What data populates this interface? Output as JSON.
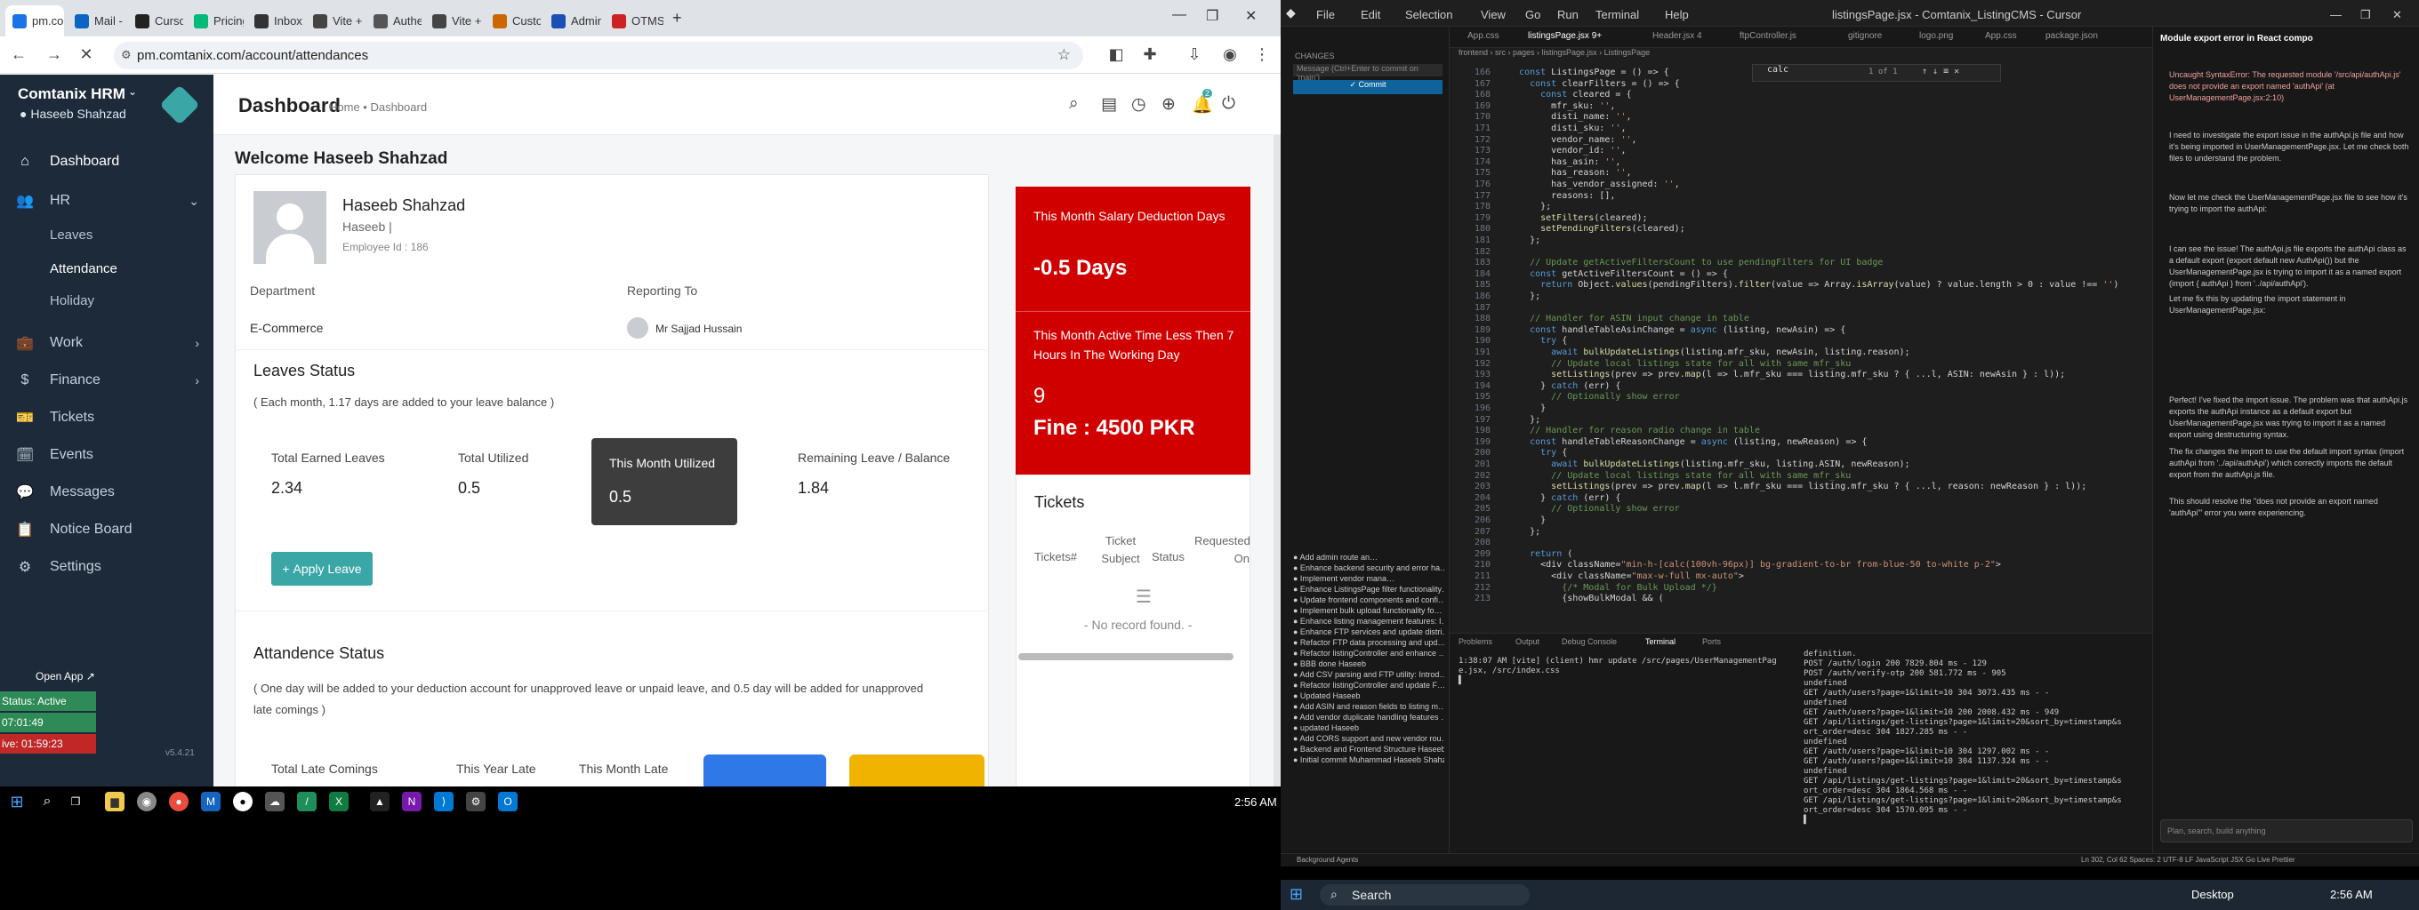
{
  "browser": {
    "tabs": [
      {
        "label": "pm.co",
        "color": "#1a73e8",
        "active": true
      },
      {
        "label": "Mail -",
        "color": "#0a66c2"
      },
      {
        "label": "Curso",
        "color": "#222"
      },
      {
        "label": "Pricing",
        "color": "#0b7"
      },
      {
        "label": "Inbox",
        "color": "#333"
      },
      {
        "label": "Vite +",
        "color": "#444"
      },
      {
        "label": "Authe",
        "color": "#555"
      },
      {
        "label": "Vite +",
        "color": "#444"
      },
      {
        "label": "Custo",
        "color": "#c60"
      },
      {
        "label": "Admin",
        "color": "#1b4fb5"
      },
      {
        "label": "OTMS",
        "color": "#c22"
      }
    ],
    "new_tab": "+",
    "url": "pm.comtanix.com/account/attendances"
  },
  "sidebar": {
    "brand": "Comtanix HRM",
    "user": "Haseeb Shahzad",
    "items": [
      {
        "label": "Dashboard",
        "icon": "⌂"
      },
      {
        "label": "HR",
        "icon": "👥"
      },
      {
        "label": "Work",
        "icon": "💼"
      },
      {
        "label": "Finance",
        "icon": "$"
      },
      {
        "label": "Tickets",
        "icon": "🎫"
      },
      {
        "label": "Events",
        "icon": "🗓"
      },
      {
        "label": "Messages",
        "icon": "💬"
      },
      {
        "label": "Notice Board",
        "icon": "📋"
      },
      {
        "label": "Settings",
        "icon": "⚙"
      }
    ],
    "hr_sub": [
      "Leaves",
      "Attendance",
      "Holiday"
    ],
    "open_app": "Open App ↗",
    "status_active": "Status: Active",
    "timer1": "07:01:49",
    "timer2": "01:59:23",
    "timer2_prefix": "ive: ",
    "version": "v5.4.21"
  },
  "header": {
    "title": "Dashboard",
    "breadcrumb": "Home • Dashboard",
    "badge": "2"
  },
  "main": {
    "welcome": "Welcome Haseeb Shahzad",
    "profile": {
      "name": "Haseeb Shahzad",
      "handle": "Haseeb |",
      "employee_id": "Employee Id : 186",
      "department_label": "Department",
      "department": "E-Commerce",
      "reporting_label": "Reporting To",
      "reporting": "Mr Sajjad Hussain"
    },
    "leaves": {
      "title": "Leaves Status",
      "note": "( Each month, 1.17 days are added to your leave balance )",
      "stats": [
        {
          "label": "Total Earned Leaves",
          "value": "2.34"
        },
        {
          "label": "Total Utilized",
          "value": "0.5"
        },
        {
          "label": "This Month Utilized",
          "value": "0.5"
        },
        {
          "label": "Remaining Leave / Balance",
          "value": "1.84"
        }
      ],
      "apply": "Apply Leave"
    },
    "attendance": {
      "title": "Attandence Status",
      "note": "( One day will be added to your deduction account for unapproved leave or unpaid leave, and 0.5 day will be added for unapproved late comings )",
      "cols": [
        "Total Late Comings",
        "This Year Late",
        "This Month Late"
      ]
    },
    "salary": {
      "title": "This Month Salary Deduction Days",
      "value": "-0.5 Days",
      "active_title": "This Month Active Time Less Then 7 Hours In The Working Day",
      "count": "9",
      "fine": "Fine : 4500 PKR"
    },
    "tickets": {
      "title": "Tickets",
      "cols": [
        "Tickets#",
        "Ticket Subject",
        "Status",
        "Requested On"
      ],
      "empty": "- No record found. -"
    }
  },
  "taskbar_left": {
    "time": "2:56 AM"
  },
  "editor": {
    "menu": [
      "File",
      "Edit",
      "Selection",
      "View",
      "Go",
      "Run",
      "Terminal",
      "Help"
    ],
    "window_title": "listingsPage.jsx - Comtanix_ListingCMS - Cursor",
    "tabs": [
      "App.css",
      "listingsPage.jsx 9+",
      "Header.jsx 4",
      "ftpController.js",
      "gitignore",
      "logo.png",
      "App.css",
      "package.json"
    ],
    "breadcrumb": "frontend › src › pages › listingsPage.jsx › ListingsPage",
    "find": "calc",
    "find_count": "1 of 1",
    "code": [
      [
        "166",
        "  const ListingsPage = () => {"
      ],
      [
        "167",
        "    const clearFilters = () => {"
      ],
      [
        "168",
        "      const cleared = {"
      ],
      [
        "169",
        "        mfr_sku: '',"
      ],
      [
        "170",
        "        disti_name: '',"
      ],
      [
        "171",
        "        disti_sku: '',"
      ],
      [
        "172",
        "        vendor_name: '',"
      ],
      [
        "173",
        "        vendor_id: '',"
      ],
      [
        "174",
        "        has_asin: '',"
      ],
      [
        "175",
        "        has_reason: '',"
      ],
      [
        "176",
        "        has_vendor_assigned: '',"
      ],
      [
        "177",
        "        reasons: [],"
      ],
      [
        "178",
        "      };"
      ],
      [
        "179",
        "      setFilters(cleared);"
      ],
      [
        "180",
        "      setPendingFilters(cleared);"
      ],
      [
        "181",
        "    };"
      ],
      [
        "182",
        ""
      ],
      [
        "183",
        "    // Update getActiveFiltersCount to use pendingFilters for UI badge"
      ],
      [
        "184",
        "    const getActiveFiltersCount = () => {"
      ],
      [
        "185",
        "      return Object.values(pendingFilters).filter(value => Array.isArray(value) ? value.length > 0 : value !== '')"
      ],
      [
        "186",
        "    };"
      ],
      [
        "187",
        ""
      ],
      [
        "188",
        "    // Handler for ASIN input change in table"
      ],
      [
        "189",
        "    const handleTableAsinChange = async (listing, newAsin) => {"
      ],
      [
        "190",
        "      try {"
      ],
      [
        "191",
        "        await bulkUpdateListings(listing.mfr_sku, newAsin, listing.reason);"
      ],
      [
        "192",
        "        // Update local listings state for all with same mfr_sku"
      ],
      [
        "193",
        "        setListings(prev => prev.map(l => l.mfr_sku === listing.mfr_sku ? { ...l, ASIN: newAsin } : l));"
      ],
      [
        "194",
        "      } catch (err) {"
      ],
      [
        "195",
        "        // Optionally show error"
      ],
      [
        "196",
        "      }"
      ],
      [
        "197",
        "    };"
      ],
      [
        "198",
        "    // Handler for reason radio change in table"
      ],
      [
        "199",
        "    const handleTableReasonChange = async (listing, newReason) => {"
      ],
      [
        "200",
        "      try {"
      ],
      [
        "201",
        "        await bulkUpdateListings(listing.mfr_sku, listing.ASIN, newReason);"
      ],
      [
        "202",
        "        // Update local listings state for all with same mfr_sku"
      ],
      [
        "203",
        "        setListings(prev => prev.map(l => l.mfr_sku === listing.mfr_sku ? { ...l, reason: newReason } : l));"
      ],
      [
        "204",
        "      } catch (err) {"
      ],
      [
        "205",
        "        // Optionally show error"
      ],
      [
        "206",
        "      }"
      ],
      [
        "207",
        "    };"
      ],
      [
        "208",
        ""
      ],
      [
        "209",
        "    return ("
      ],
      [
        "210",
        "      <div className=\"min-h-[calc(100vh-96px)] bg-gradient-to-br from-blue-50 to-white p-2\">"
      ],
      [
        "211",
        "        <div className=\"max-w-full mx-auto\">"
      ],
      [
        "212",
        "          {/* Modal for Bulk Upload */}"
      ],
      [
        "213",
        "          {showBulkModal && ("
      ]
    ],
    "scm_header": "CHANGES",
    "scm_msg": "Message (Ctrl+Enter to commit on 'main')",
    "scm_commit": "✓ Commit",
    "commits": [
      "Add admin route an…",
      "Enhance backend security and error ha…",
      "Implement vendor mana…",
      "Enhance ListingsPage filter functionality…",
      "Update frontend components and confi…",
      "Implement bulk upload functionality fo…",
      "Enhance listing management features: I…",
      "Enhance FTP services and update distri…",
      "Refactor FTP data processing and upd…",
      "Refactor listingController and enhance …",
      "BBB done  Haseeb",
      "Add CSV parsing and FTP utility: Introd…",
      "Refactor listingController and update F…",
      "Updated  Haseeb",
      "Add ASIN and reason fields to listing m…",
      "Add vendor duplicate handling features …",
      "updated  Haseeb",
      "Add CORS support and new vendor rou…",
      "Backend and Frontend Structure  Haseeb",
      "Initial commit  Muhammad Haseeb Shahzad"
    ],
    "panel_tabs": [
      "Problems",
      "Output",
      "Debug Console",
      "Terminal",
      "Ports"
    ],
    "term_left": [
      "1:38:07 AM [vite] (client) hmr update /src/pages/UserManagementPag",
      "e.jsx, /src/index.css",
      "▌"
    ],
    "term_right": [
      "definition.",
      "POST /auth/login 200 7829.804 ms - 129",
      "POST /auth/verify-otp 200 581.772 ms - 905",
      "undefined",
      "GET /auth/users?page=1&limit=10 304 3073.435 ms - -",
      "undefined",
      "GET /auth/users?page=1&limit=10 200 2008.432 ms - 949",
      "GET /api/listings/get-listings?page=1&limit=20&sort_by=timestamp&s",
      "ort_order=desc 304 1827.285 ms - -",
      "undefined",
      "GET /auth/users?page=1&limit=10 304 1297.002 ms - -",
      "GET /auth/users?page=1&limit=10 304 1137.324 ms - -",
      "undefined",
      "GET /api/listings/get-listings?page=1&limit=20&sort_by=timestamp&s",
      "ort_order=desc 304 1864.568 ms - -",
      "GET /api/listings/get-listings?page=1&limit=20&sort_by=timestamp&s",
      "ort_order=desc 304 1570.095 ms - -",
      "▌"
    ],
    "chat_title": "Module export error in React compo",
    "chat_paragraphs": [
      "Uncaught SyntaxError: The requested module '/src/api/authApi.js' does not provide an export named 'authApi' (at UserManagementPage.jsx:2:10)",
      "I need to investigate the export issue in the authApi.js file and how it's being imported in UserManagementPage.jsx. Let me check both files to understand the problem.",
      "Now let me check the UserManagementPage.jsx file to see how it's trying to import the authApi:",
      "I can see the issue! The authApi.js file exports the authApi class as a default export (export default new AuthApi()) but the UserManagementPage.jsx is trying to import it as a named export (import { authApi } from '../api/authApi').",
      "Let me fix this by updating the import statement in UserManagementPage.jsx:",
      "Perfect! I've fixed the import issue. The problem was that authApi.js exports the authApi instance as a default export but UserManagementPage.jsx was trying to import it as a named export using destructuring syntax.",
      "The fix changes the import to use the default import syntax (import authApi from '../api/authApi') which correctly imports the default export from the authApi.js file.",
      "This should resolve the \"does not provide an export named 'authApi'\" error you were experiencing."
    ],
    "chat_input": "Plan, search, build anything",
    "status_left": "Background Agents",
    "status_right": "Ln 302, Col 62   Spaces: 2   UTF-8   LF   JavaScript JSX   Go Live   Prettier"
  },
  "taskbar_right": {
    "search": "Search",
    "desktop": "Desktop",
    "time": "2:56 AM"
  }
}
